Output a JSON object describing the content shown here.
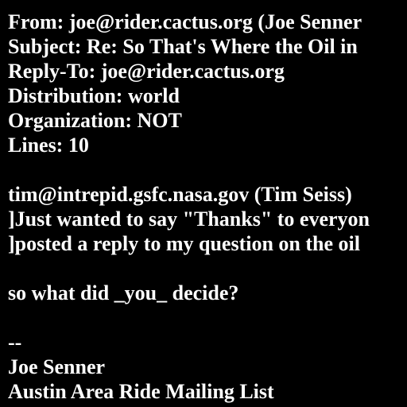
{
  "message": {
    "header": {
      "from": "From: joe@rider.cactus.org (Joe Senner",
      "subject": "Subject: Re: So That's Where the Oil in",
      "reply_to": "Reply-To: joe@rider.cactus.org",
      "distribution": "Distribution: world",
      "organization": "Organization: NOT",
      "lines": "Lines: 10"
    },
    "body": {
      "attribution": "tim@intrepid.gsfc.nasa.gov (Tim Seiss)",
      "quote_1": "]Just wanted to say \"Thanks\" to everyon",
      "quote_2": "]posted a reply to my question on the oil",
      "question": "so what did _you_ decide?",
      "sig_separator": "--",
      "sig_name": "Joe Senner",
      "sig_list": "Austin Area Ride Mailing List"
    }
  },
  "colors": {
    "background": "#000000",
    "text": "#ffffff"
  }
}
